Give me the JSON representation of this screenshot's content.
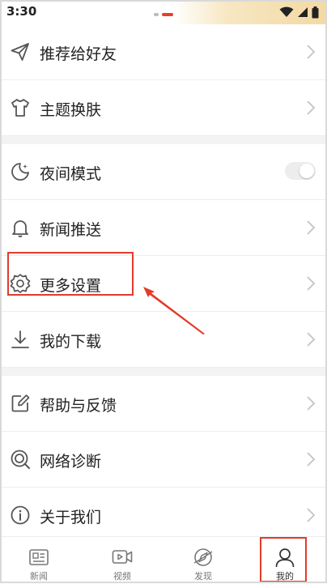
{
  "status_bar": {
    "time": "3:30"
  },
  "menu": {
    "items": [
      {
        "label": "推荐给好友",
        "icon": "send-icon"
      },
      {
        "label": "主题换肤",
        "icon": "tshirt-icon"
      },
      {
        "label": "夜间模式",
        "icon": "moon-icon",
        "toggle_on": false
      },
      {
        "label": "新闻推送",
        "icon": "bell-icon"
      },
      {
        "label": "更多设置",
        "icon": "gear-icon"
      },
      {
        "label": "我的下载",
        "icon": "download-icon"
      },
      {
        "label": "帮助与反馈",
        "icon": "edit-icon"
      },
      {
        "label": "网络诊断",
        "icon": "network-icon"
      },
      {
        "label": "关于我们",
        "icon": "info-icon"
      }
    ]
  },
  "bottom_nav": {
    "items": [
      {
        "label": "新闻",
        "icon": "news-icon"
      },
      {
        "label": "视频",
        "icon": "video-icon"
      },
      {
        "label": "发现",
        "icon": "discover-icon"
      },
      {
        "label": "我的",
        "icon": "profile-icon",
        "active": true
      }
    ]
  },
  "colors": {
    "highlight": "#e23b2c",
    "accent_red": "#e2402d"
  }
}
